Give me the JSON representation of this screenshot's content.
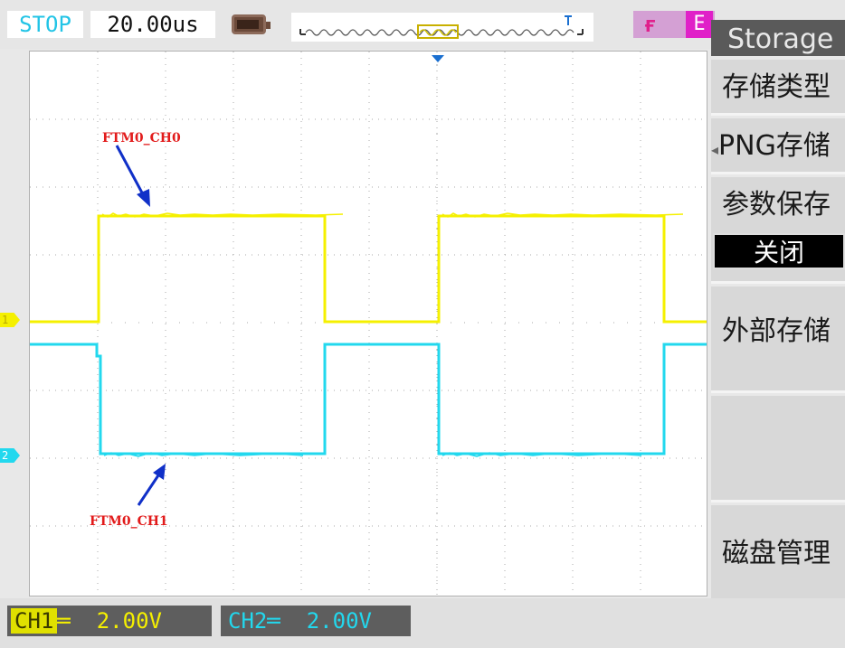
{
  "header": {
    "run_state": "STOP",
    "timebase": "20.00us",
    "battery_icon": "battery-icon",
    "trigger_edge_icon": "rising-edge-icon",
    "trigger_source": "E"
  },
  "waveform": {
    "colors": {
      "ch1": "#f5f000",
      "ch2": "#22d8ee",
      "grid": "#a8a8a8",
      "annotation": "#e21b1b",
      "arrow": "#1030c8"
    },
    "ch1_marker": "1",
    "ch2_marker": "2",
    "annotations": {
      "ch1": "FTM0_CH0",
      "ch2": "FTM0_CH1"
    }
  },
  "menu": {
    "title": "Storage",
    "items": [
      {
        "label": "存储类型"
      },
      {
        "label": "PNG存储",
        "prefix": "◂"
      },
      {
        "label": "参数保存",
        "value": "关闭"
      },
      {
        "label": "外部存储"
      },
      {
        "label": ""
      },
      {
        "label": "磁盘管理"
      }
    ]
  },
  "footer": {
    "ch1_label": "CH1",
    "ch1_coupling": "═",
    "ch1_scale": "2.00V",
    "ch2_label": "CH2",
    "ch2_coupling": "═",
    "ch2_scale": "2.00V"
  }
}
